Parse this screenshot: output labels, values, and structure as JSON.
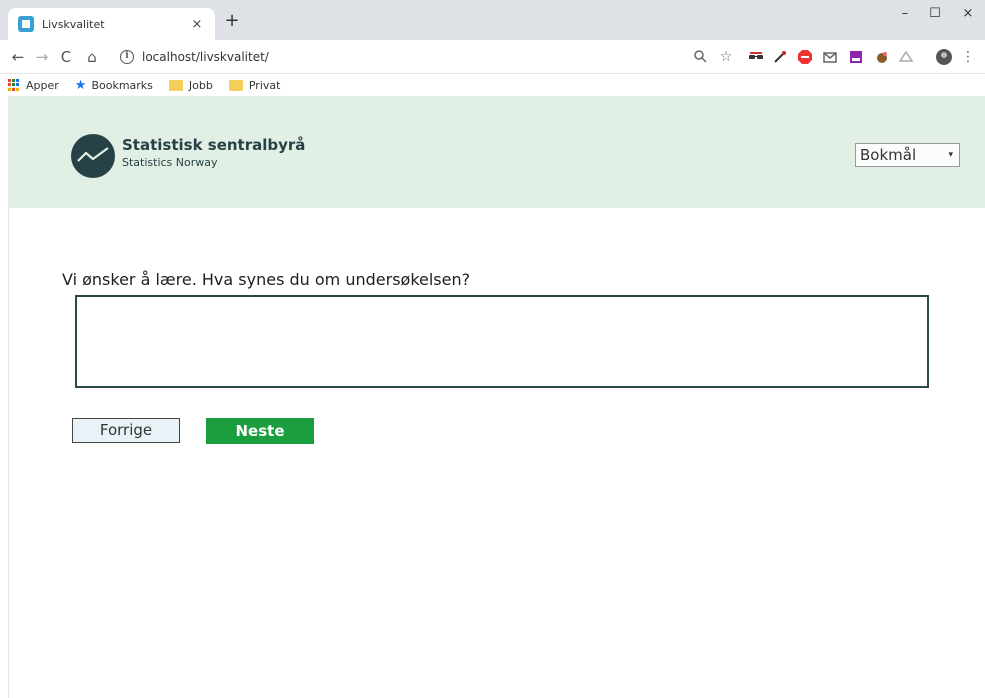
{
  "browser": {
    "tab": {
      "title": "Livskvalitet",
      "close": "×"
    },
    "new_tab": "+",
    "window_controls": {
      "minimize": "–",
      "maximize": "☐",
      "close": "×"
    },
    "nav": {
      "back": "←",
      "forward": "→",
      "reload": "C",
      "home": "⌂"
    },
    "url": "localhost/livskvalitet/",
    "info_glyph": "i",
    "bookmarks": [
      {
        "label": "Apper",
        "icon": "apps-grid-icon"
      },
      {
        "label": "Bookmarks",
        "icon": "star-icon"
      },
      {
        "label": "Jobb",
        "icon": "folder-icon"
      },
      {
        "label": "Privat",
        "icon": "folder-icon"
      }
    ]
  },
  "header": {
    "logo_title": "Statistisk sentralbyrå",
    "logo_subtitle": "Statistics Norway",
    "language_selected": "Bokmål",
    "language_arrow": "▾",
    "bg_color": "#e2efe4"
  },
  "form": {
    "question": "Vi ønsker å lære. Hva synes du om undersøkelsen?",
    "answer_value": ""
  },
  "buttons": {
    "previous": "Forrige",
    "next": "Neste",
    "next_color": "#1a9e3e"
  }
}
